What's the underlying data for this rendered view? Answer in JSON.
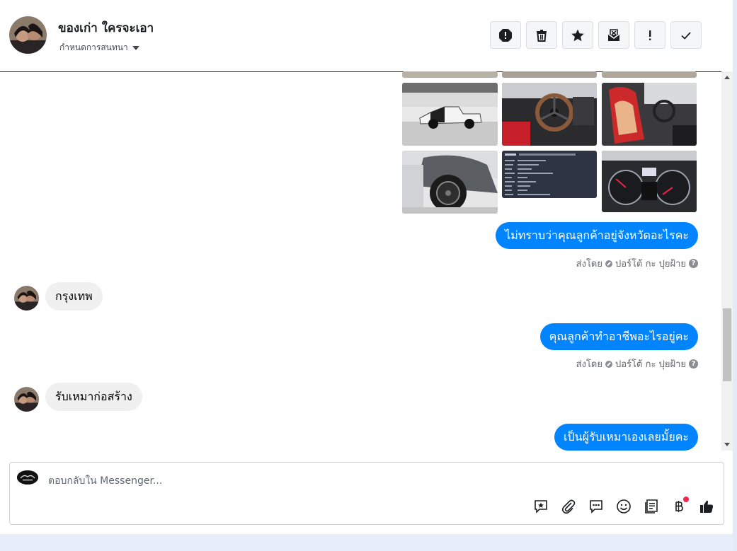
{
  "header": {
    "title": "ของเก่า ใครจะเอา",
    "assign_label": "กำหนดการสนทนา",
    "actions": [
      "report-icon",
      "delete-icon",
      "star-icon",
      "spam-icon",
      "important-icon",
      "done-icon"
    ]
  },
  "messages": {
    "out1": "ไม่ทราบว่าคุณลูกค้าอยู่จังหวัดอะไรคะ",
    "in1": "กรุงเทพ",
    "out2": "คุณลูกค้าทำอาชีพอะไรอยู่คะ",
    "in2": "รับเหมาก่อสร้าง",
    "out3": "เป็นผู้รับเหมาเองเลยมั้ยคะ",
    "sent_by_prefix": "ส่งโดย",
    "sent_by_name": "ปอร์โต้ กะ ปุยฝ้าย"
  },
  "composer": {
    "placeholder": "ตอบกลับใน Messenger...",
    "tools": [
      "saved-reply-icon",
      "attach-icon",
      "chat-bubble-icon",
      "emoji-icon",
      "catalog-icon",
      "baht-payment-icon",
      "like-icon"
    ]
  },
  "colors": {
    "outgoing_bubble": "#0084ff",
    "incoming_bubble": "#f0f0f0",
    "notification_dot": "#f02849"
  }
}
